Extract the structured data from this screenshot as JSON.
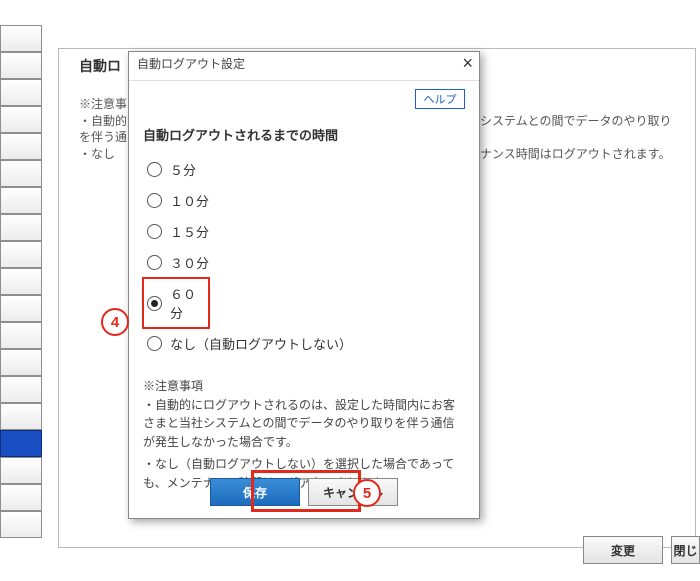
{
  "page": {
    "title_prefix": "自動ロ",
    "note_label": "※注意事",
    "desc_line1_left": "・自動的",
    "desc_line1_right": "システムとの間でデータのやり取り",
    "desc_line2": "を伴う通",
    "desc_line3_left": "・なし",
    "desc_line3_right": "ナンス時間はログアウトされます。",
    "buttons": {
      "change": "変更",
      "close": "閉じ"
    }
  },
  "dialog": {
    "title": "自動ログアウト設定",
    "help": "ヘルプ",
    "section_title": "自動ログアウトされるまでの時間",
    "options": [
      {
        "label": "５分",
        "selected": false
      },
      {
        "label": "１０分",
        "selected": false
      },
      {
        "label": "１５分",
        "selected": false
      },
      {
        "label": "３０分",
        "selected": false
      },
      {
        "label": "６０分",
        "selected": true
      },
      {
        "label": "なし（自動ログアウトしない）",
        "selected": false
      }
    ],
    "note_heading": "※注意事項",
    "note_line1": "・自動的にログアウトされるのは、設定した時間内にお客さまと当社システムとの間でデータのやり取りを伴う通信が発生しなかった場合です。",
    "note_line2": "・なし（自動ログアウトしない）を選択した場合であっても、メンテナンス時間はログアウトされます。",
    "buttons": {
      "save": "保存",
      "cancel": "キャンセル"
    }
  },
  "markers": {
    "step4": "4",
    "step5": "5"
  }
}
